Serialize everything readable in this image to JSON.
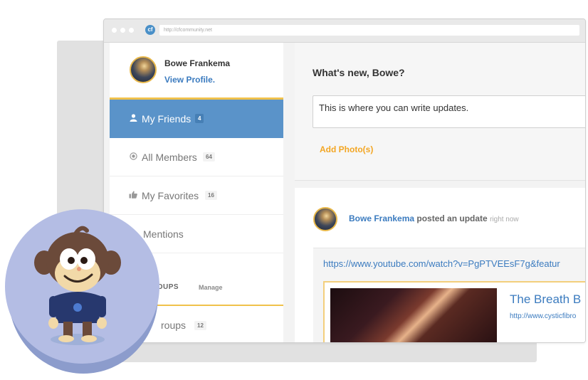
{
  "browser": {
    "url": "http://cfcommunity.net",
    "site_icon": "cf"
  },
  "profile": {
    "name": "Bowe Frankema",
    "link": "View Profile."
  },
  "nav": [
    {
      "label": "My Friends",
      "count": "4",
      "icon": "user-icon",
      "active": true
    },
    {
      "label": "All Members",
      "count": "64",
      "icon": "target-icon",
      "active": false
    },
    {
      "label": "My Favorites",
      "count": "16",
      "icon": "thumbs-up-icon",
      "active": false
    },
    {
      "label": "Mentions",
      "count": "",
      "icon": "at-icon",
      "active": false
    }
  ],
  "groups_section": {
    "title": "ROUPS",
    "manage": "Manage"
  },
  "groups_item": {
    "label": "roups",
    "count": "12"
  },
  "composer": {
    "title": "What's new, Bowe?",
    "text": "This is where you can write updates.",
    "add_photos": "Add Photo(s)"
  },
  "post": {
    "author": "Bowe Frankema",
    "action": "posted an update",
    "time": "right now",
    "url": "https://www.youtube.com/watch?v=PgPTVEEsF7g&featur",
    "preview_title": "The Breath B",
    "preview_link": "http://www.cysticfibro"
  },
  "colors": {
    "accent_blue": "#5a93c9",
    "link_blue": "#3b7bbf",
    "gold": "#f0c14b",
    "mascot_bg": "#b4bde4"
  }
}
